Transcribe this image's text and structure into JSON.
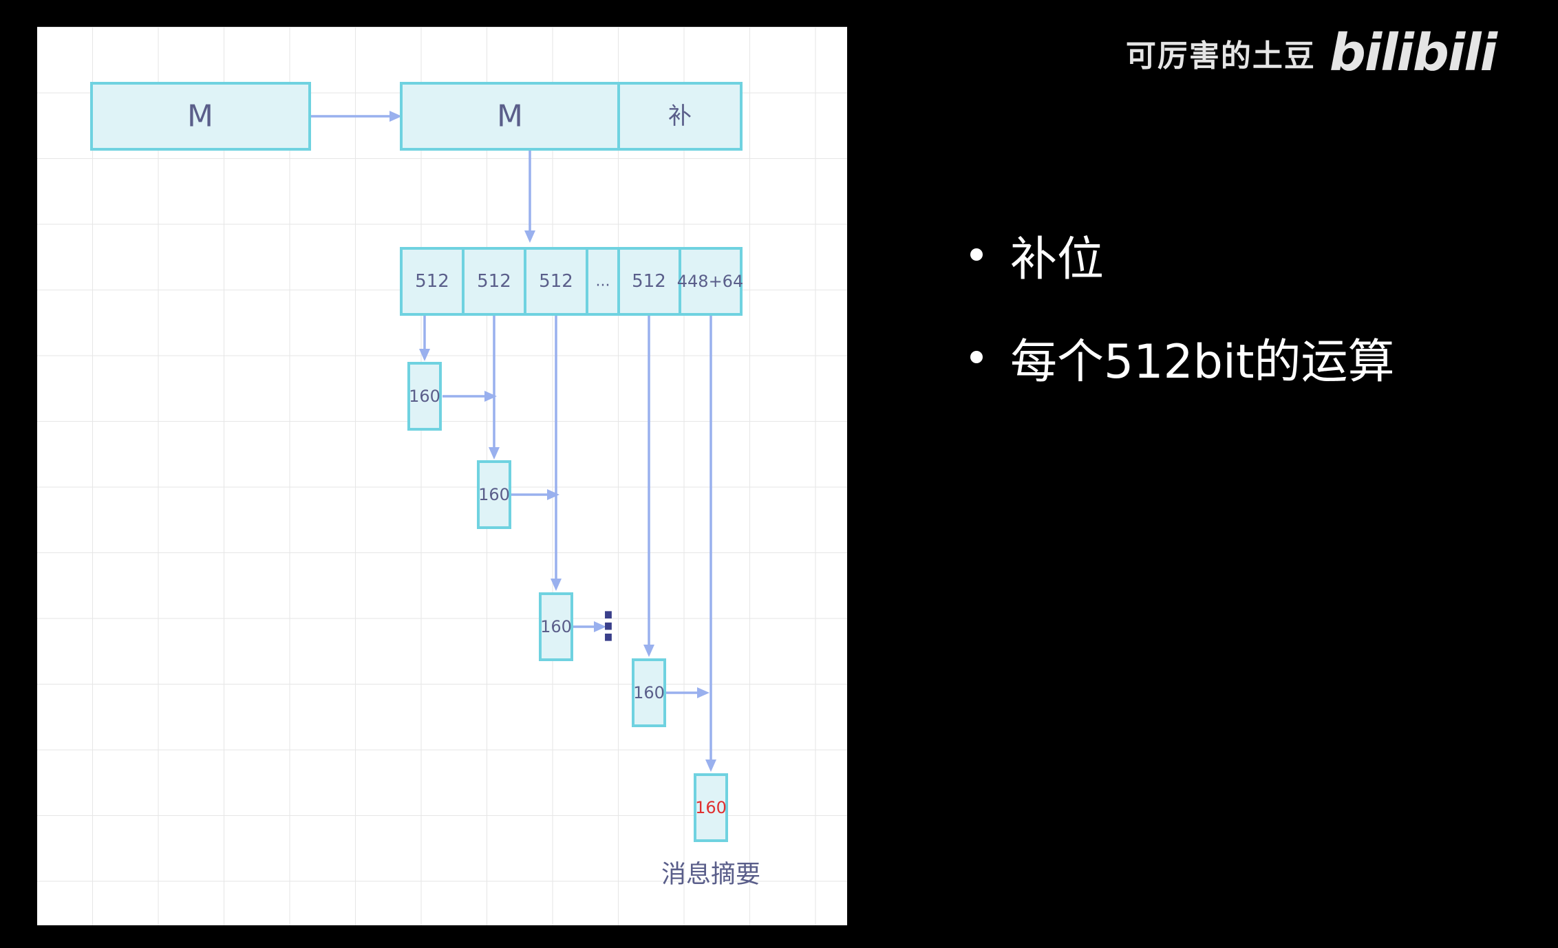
{
  "watermark": {
    "text": "可厉害的土豆",
    "logo": "bilibili"
  },
  "bullets": [
    {
      "text": "补位"
    },
    {
      "text": "每个512bit的运算"
    }
  ],
  "diagram": {
    "message_label": "M",
    "padded_message_label": "M",
    "padding_label": "补",
    "blocks": [
      "512",
      "512",
      "512",
      "...",
      "512",
      "448+64"
    ],
    "states": [
      "160",
      "160",
      "160",
      "160"
    ],
    "final_state": "160",
    "final_state_color": "#e03030",
    "digest_label": "消息摘要",
    "continuation_marker": "⋮"
  },
  "colors": {
    "box_fill": "#dff3f7",
    "box_border": "#6fd2e0",
    "arrow": "#99b0ee",
    "text": "#5a5e8a"
  }
}
